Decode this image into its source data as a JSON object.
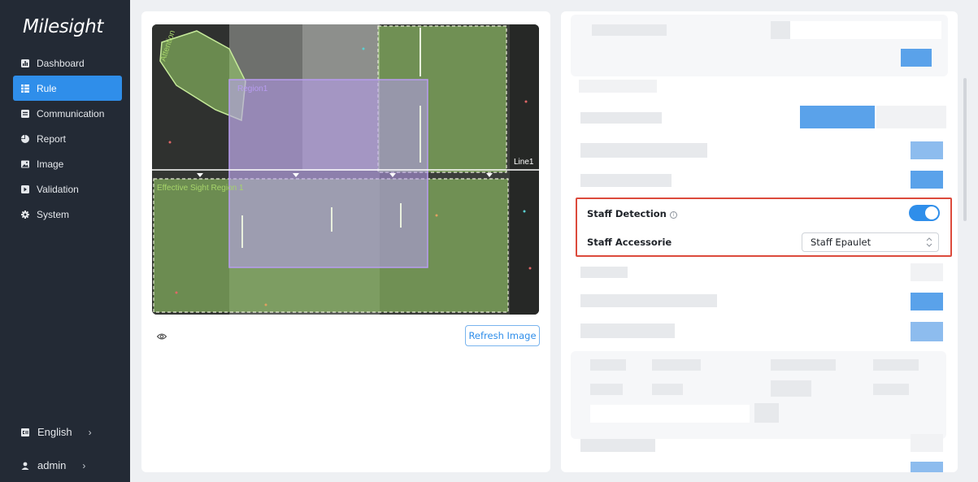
{
  "brand": {
    "logo_text": "Milesight"
  },
  "nav": {
    "items": [
      {
        "label": "Dashboard",
        "icon": "bar-chart-icon",
        "active": false
      },
      {
        "label": "Rule",
        "icon": "list-icon",
        "active": true
      },
      {
        "label": "Communication",
        "icon": "message-icon",
        "active": false
      },
      {
        "label": "Report",
        "icon": "pie-chart-icon",
        "active": false
      },
      {
        "label": "Image",
        "icon": "image-icon",
        "active": false
      },
      {
        "label": "Validation",
        "icon": "validation-icon",
        "active": false
      },
      {
        "label": "System",
        "icon": "gear-icon",
        "active": false
      }
    ]
  },
  "sidebar_bottom": {
    "language": {
      "label": "English",
      "icon": "language-icon",
      "chevron": "›"
    },
    "user": {
      "label": "admin",
      "icon": "user-icon",
      "chevron": "›"
    }
  },
  "camera_view": {
    "overlays": {
      "attention_label": "Attention",
      "region_label": "Region1",
      "line_label": "Line1",
      "effective_region_label": "Effective Sight Region 1"
    }
  },
  "left_panel": {
    "eye_icon": "eye-icon",
    "refresh_button_label": "Refresh Image"
  },
  "settings": {
    "staff_detection": {
      "label": "Staff Detection",
      "info_icon": "ⓘ",
      "enabled": true
    },
    "staff_accessorie": {
      "label": "Staff Accessorie",
      "selected": "Staff Epaulet"
    }
  },
  "colors": {
    "sidebar_bg": "#232a35",
    "accent": "#2f8eea",
    "highlight_border": "#dc4a3c",
    "region_green": "#9bd46a",
    "region_purple": "#b89cf0"
  }
}
